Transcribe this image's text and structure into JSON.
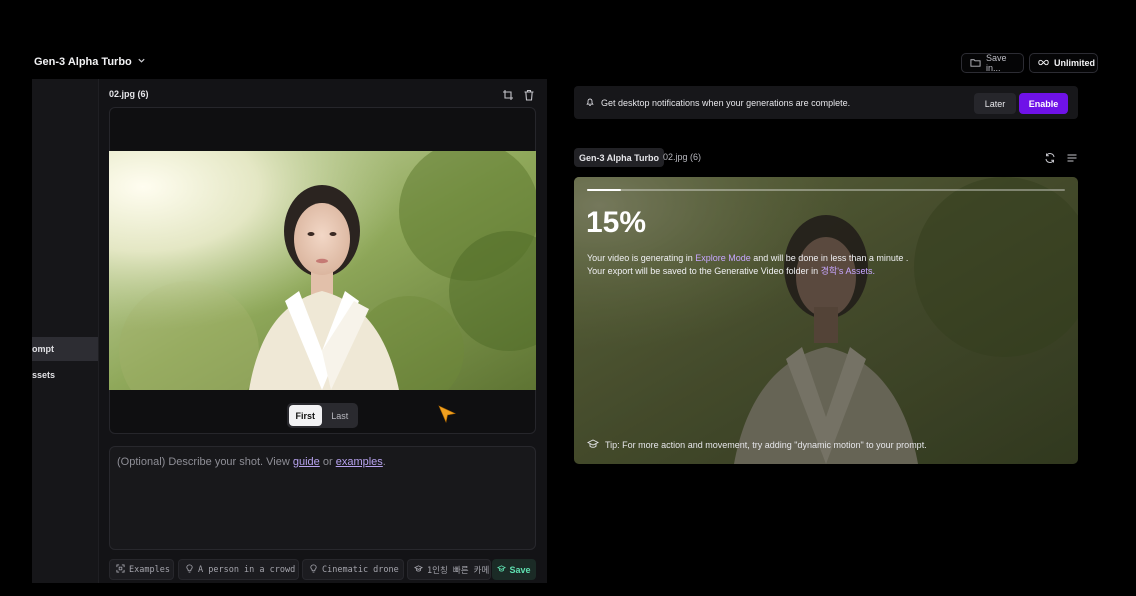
{
  "header": {
    "model_name": "Gen-3 Alpha Turbo",
    "save_in_label": "Save in...",
    "unlimited_label": "Unlimited"
  },
  "sidebar": {
    "items": [
      {
        "label": "ompt",
        "active": true
      },
      {
        "label": "ssets",
        "active": false
      }
    ]
  },
  "editor": {
    "file_title": "02.jpg (6)",
    "frame_toggle": {
      "first": "First",
      "last": "Last",
      "selected": "First"
    },
    "prompt": {
      "prefix": "(Optional) Describe your shot. View ",
      "guide_link": "guide",
      "or_text": " or ",
      "examples_link": "examples",
      "suffix": "."
    },
    "chips": [
      {
        "label": "Examples",
        "icon": "scan-icon"
      },
      {
        "label": "A person in a crowd",
        "icon": "bulb-icon"
      },
      {
        "label": "Cinematic drone",
        "icon": "bulb-icon"
      },
      {
        "label": "1인칭 빠른 카메",
        "icon": "cap-icon"
      }
    ],
    "save_label": "Save"
  },
  "notification": {
    "text": "Get desktop notifications when your generations are complete.",
    "later_label": "Later",
    "enable_label": "Enable"
  },
  "generation": {
    "model_badge": "Gen-3 Alpha Turbo",
    "file_name": "02.jpg (6)",
    "progress_fraction": 0.15,
    "percent_label": "15%",
    "line1_prefix": "Your video is generating in ",
    "line1_mode": "Explore Mode",
    "line1_suffix": " and will be done in less than a minute .",
    "line2_prefix": "Your export will be saved to the Generative Video folder in ",
    "line2_user": "경학",
    "line2_suffix": "'s Assets.",
    "tip": "Tip: For more action and movement, try adding \"dynamic motion\" to your prompt."
  },
  "colors": {
    "accent": "#6f12e8",
    "link": "#b8a3f0",
    "highlight": "#c7a6ff",
    "save": "#5fe0b0",
    "cursor": "#f0a020"
  }
}
